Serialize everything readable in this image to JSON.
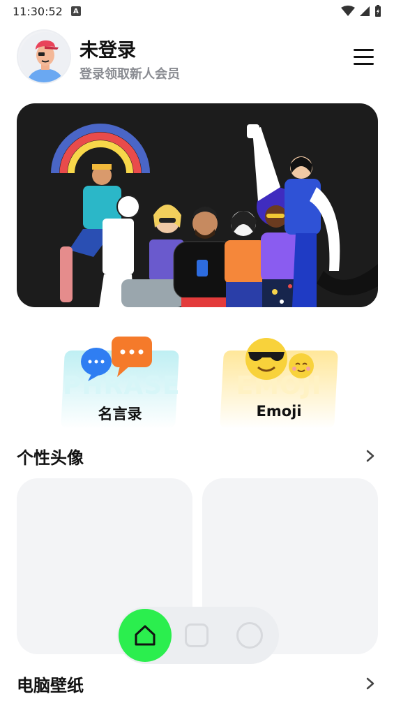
{
  "status_bar": {
    "time": "11:30:52",
    "notification_icon": "a-icon",
    "icons": [
      "wifi-icon",
      "signal-icon",
      "battery-icon"
    ]
  },
  "profile": {
    "title": "未登录",
    "subtitle": "登录领取新人会员",
    "avatar_icon": "user-avatar-icon",
    "menu_icon": "hamburger-menu-icon"
  },
  "banner": {
    "illustration": "group-of-diverse-people-with-rainbow"
  },
  "features": [
    {
      "label": "名言录",
      "watermark": "PHRASE",
      "icon": "chat-bubbles-icon",
      "color": "#bff0f3"
    },
    {
      "label": "Emoji",
      "watermark": "EMOJI",
      "icon": "sunglasses-emoji-icon",
      "color": "#ffe9a3"
    }
  ],
  "sections": [
    {
      "title": "个性头像",
      "icon": "chevron-right-icon"
    },
    {
      "title": "电脑壁纸",
      "icon": "chevron-right-icon"
    }
  ],
  "bottom_nav": {
    "items": [
      "home-icon",
      "square-icon",
      "circle-icon"
    ],
    "accent": "#2bee4e"
  }
}
